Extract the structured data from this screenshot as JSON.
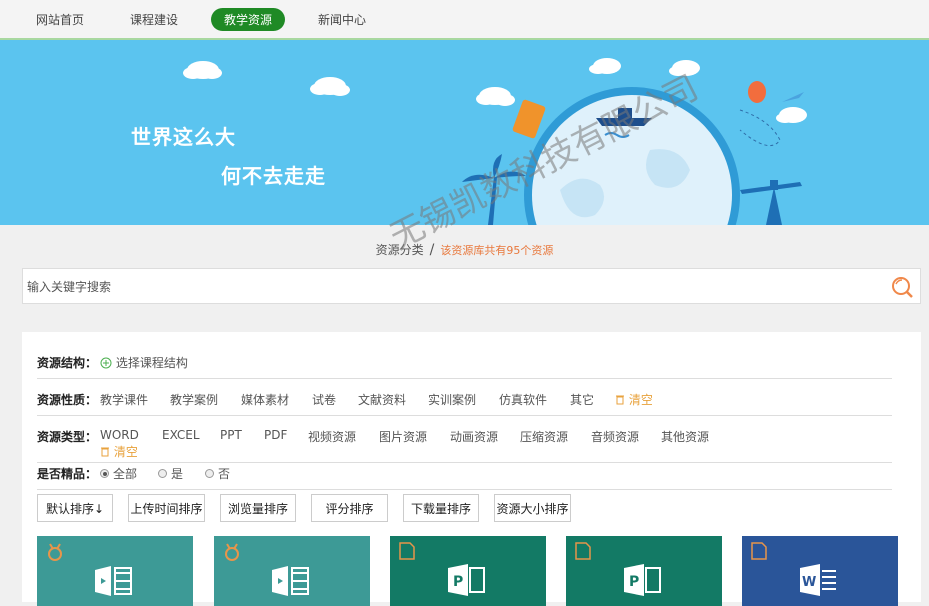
{
  "nav": {
    "items": [
      {
        "label": "网站首页",
        "active": false
      },
      {
        "label": "课程建设",
        "active": false
      },
      {
        "label": "教学资源",
        "active": true
      },
      {
        "label": "新闻中心",
        "active": false
      }
    ]
  },
  "banner": {
    "slogan1": "世界这么大",
    "slogan2": "何不去走走"
  },
  "breadcrumb": {
    "section": "资源分类",
    "separator": "/",
    "count_text": "该资源库共有95个资源"
  },
  "search": {
    "placeholder": "输入关键字搜索"
  },
  "filters": {
    "structure": {
      "label": "资源结构：",
      "action": "选择课程结构"
    },
    "nature": {
      "label": "资源性质：",
      "options": [
        "教学课件",
        "教学案例",
        "媒体素材",
        "试卷",
        "文献资料",
        "实训案例",
        "仿真软件",
        "其它"
      ],
      "clear": "清空"
    },
    "type": {
      "label": "资源类型：",
      "options": [
        "WORD",
        "EXCEL",
        "PPT",
        "PDF",
        "视频资源",
        "图片资源",
        "动画资源",
        "压缩资源",
        "音频资源",
        "其他资源"
      ],
      "clear": "清空"
    },
    "featured": {
      "label": "是否精品：",
      "options": [
        "全部",
        "是",
        "否"
      ],
      "selected": "全部"
    }
  },
  "sort": {
    "buttons": [
      "默认排序↓",
      "上传时间排序",
      "浏览量排序",
      "评分排序",
      "下载量排序",
      "资源大小排序"
    ]
  },
  "cards": [
    {
      "kind": "video",
      "color": "#3d9a96",
      "badge": "medal-icon"
    },
    {
      "kind": "video",
      "color": "#3d9a96",
      "badge": "medal-icon"
    },
    {
      "kind": "ppt",
      "color": "#137a65",
      "badge": "ppt-badge-icon"
    },
    {
      "kind": "ppt",
      "color": "#137a65",
      "badge": "ppt-badge-icon"
    },
    {
      "kind": "word",
      "color": "#2a5599",
      "badge": "word-badge-icon"
    }
  ],
  "watermark": "无锡凯数科技有限公司",
  "colors": {
    "nav_active": "#1f8a25",
    "banner": "#5bc4ef",
    "accent_orange": "#e8783c"
  }
}
